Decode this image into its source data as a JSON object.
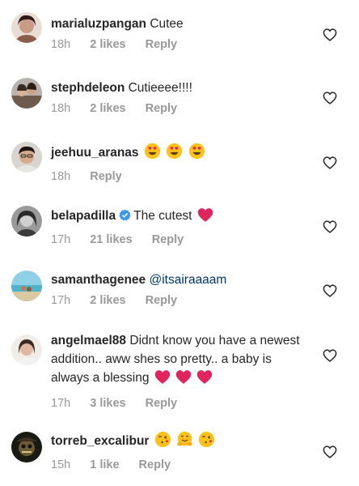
{
  "comments": [
    {
      "username": "marialuzpangan",
      "text": "Cutee",
      "time": "18h",
      "likes": "2 likes",
      "reply": "Reply"
    },
    {
      "username": "stephdeleon",
      "text": "Cutieeee!!!!",
      "time": "18h",
      "likes": "2 likes",
      "reply": "Reply"
    },
    {
      "username": "jeehuu_aranas",
      "text": "",
      "emojis": [
        "heart-eyes-emoji",
        "heart-eyes-emoji",
        "heart-eyes-emoji"
      ],
      "time": "18h",
      "likes": "",
      "reply": "Reply"
    },
    {
      "username": "belapadilla",
      "verified": true,
      "text": "The cutest",
      "emojis": [
        "red-heart-emoji"
      ],
      "time": "17h",
      "likes": "21 likes",
      "reply": "Reply"
    },
    {
      "username": "samanthagenee",
      "mention": "@itsairaaaam",
      "time": "17h",
      "likes": "2 likes",
      "reply": "Reply"
    },
    {
      "username": "angelmael88",
      "text": "Didnt know you have a newest addition.. aww shes so pretty.. a baby is always a blessing",
      "emojis": [
        "red-heart-emoji",
        "red-heart-emoji",
        "red-heart-emoji"
      ],
      "time": "17h",
      "likes": "3 likes",
      "reply": "Reply"
    },
    {
      "username": "torreb_excalibur",
      "text": "",
      "emojis": [
        "kissing-heart-emoji",
        "hugging-emoji",
        "kissing-heart-emoji"
      ],
      "time": "15h",
      "likes": "1 like",
      "reply": "Reply"
    }
  ],
  "colors": {
    "text": "#262626",
    "meta": "#999999",
    "mention": "#003569",
    "verified": "#3897f0",
    "heart": "#e0245e"
  },
  "icons": {
    "like": "heart-outline-icon",
    "verified": "verified-badge-icon"
  }
}
